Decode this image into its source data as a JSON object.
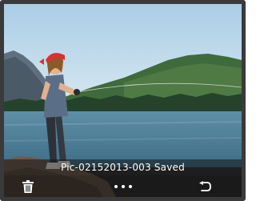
{
  "status": {
    "saved_message": "Pic-02152013-003 Saved"
  },
  "toolbar": {
    "delete_icon": "trash-icon",
    "more_icon": "more-dots-icon",
    "back_icon": "undo-arrow-icon"
  },
  "colors": {
    "icon": "#ffffff",
    "overlay": "#141414",
    "frame": "#3a3a3a"
  }
}
